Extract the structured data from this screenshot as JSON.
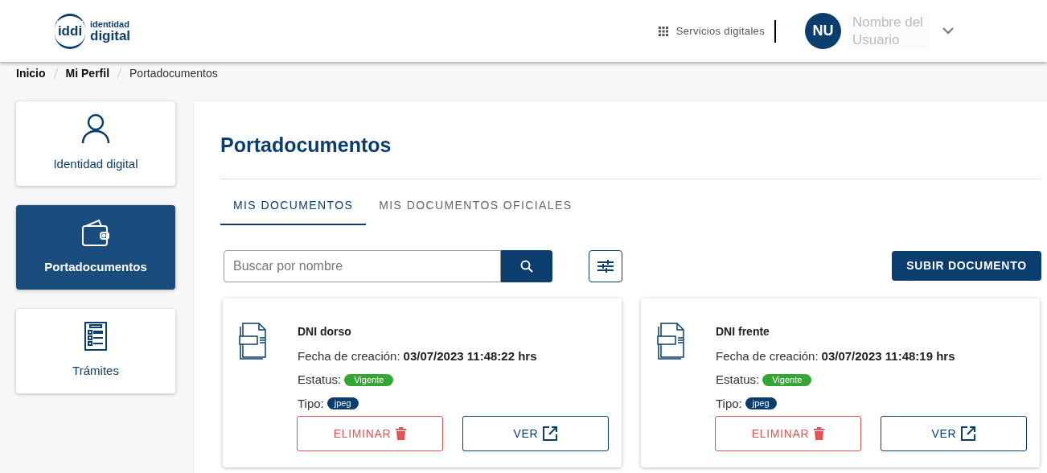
{
  "header": {
    "logo": {
      "mark": "iddi",
      "line_1": "identidad",
      "line_2": "digital"
    },
    "services_link": "Servicios digitales",
    "user": {
      "initials": "NU",
      "name": "Nombre del Usuario"
    }
  },
  "breadcrumb": [
    {
      "label": "Inicio",
      "current": false
    },
    {
      "label": "Mi Perfil",
      "current": false
    },
    {
      "label": "Portadocumentos",
      "current": true
    }
  ],
  "sidebar": {
    "items": [
      {
        "label": "Identidad digital",
        "kind": "person",
        "selected": false
      },
      {
        "label": "Portadocumentos",
        "kind": "wallet",
        "selected": true
      },
      {
        "label": "Trámites",
        "kind": "checklist",
        "selected": false
      }
    ]
  },
  "main": {
    "title": "Portadocumentos",
    "tabs": [
      {
        "label": "MIS DOCUMENTOS",
        "selected": true
      },
      {
        "label": "MIS DOCUMENTOS OFICIALES",
        "selected": false
      }
    ],
    "search": {
      "placeholder": "Buscar por nombre"
    },
    "upload_button": "SUBIR DOCUMENTO",
    "documents": [
      {
        "name": "DNI dorso",
        "date_label": "Fecha de creación:",
        "date": "03/07/2023 11:48:22 hrs",
        "status_label": "Estatus:",
        "status": "Vigente",
        "type_label": "Tipo:",
        "type": "jpeg",
        "delete": "ELIMINAR",
        "view": "VER"
      },
      {
        "name": "DNI frente",
        "date_label": "Fecha de creación:",
        "date": "03/07/2023 11:48:19 hrs",
        "status_label": "Estatus:",
        "status": "Vigente",
        "type_label": "Tipo:",
        "type": "jpeg",
        "delete": "ELIMINAR",
        "view": "VER"
      }
    ]
  }
}
